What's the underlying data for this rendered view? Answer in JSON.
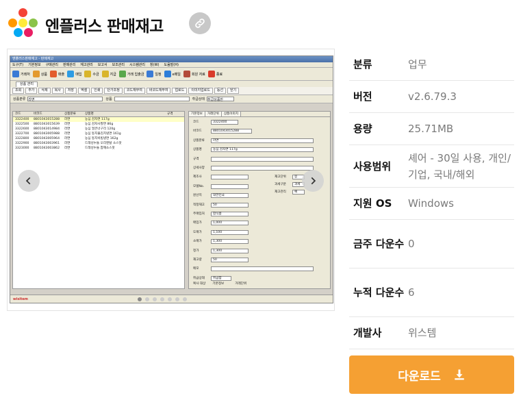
{
  "app": {
    "title": "엔플러스 판매재고",
    "logo_colors": [
      "#f44336",
      "#ff9800",
      "#ffeb3b",
      "#8bc34a",
      "#03a9f4",
      "#e91e63"
    ]
  },
  "screenshot": {
    "window_title": "엔플러스판매재고 - 판매재고",
    "menu": [
      "도구(T)",
      "기본정보",
      "구매관리",
      "판매관리",
      "재고관리",
      "보고서",
      "보조관리",
      "시스템관리",
      "창(W)",
      "도움말(H)"
    ],
    "toolbar": [
      {
        "label": "거래처",
        "color": "#3a7bd5"
      },
      {
        "label": "상품",
        "color": "#e39a2d"
      },
      {
        "label": "매출",
        "color": "#e35d2d"
      },
      {
        "label": "매입",
        "color": "#2d9ce3"
      },
      {
        "label": "수금",
        "color": "#d9b52b"
      },
      {
        "label": "지급",
        "color": "#d9b52b"
      },
      {
        "label": "거래 입출금",
        "color": "#59a84b"
      },
      {
        "label": "일정",
        "color": "#3a7bd5"
      },
      {
        "label": "e메일",
        "color": "#2d7ed9"
      },
      {
        "label": "회원 자료",
        "color": "#b34b3a"
      },
      {
        "label": "종료",
        "color": "#d93b2b"
      }
    ],
    "tab": "상품 관리",
    "subtoolbar": [
      "조회",
      "추가",
      "삭제",
      "복사",
      "저장",
      "엑셀",
      "인쇄",
      "단가조정",
      "코드재부여",
      "바코드재부여",
      "업로드",
      "이미지업로드",
      "등선",
      "닫기"
    ],
    "search": {
      "category_label": "상품분류",
      "category_value": "라면",
      "product_label": "상품",
      "status_label": "취급상태",
      "status_value": "취급상품만"
    },
    "grid": {
      "headers": [
        "코드",
        "바코드",
        "상품분류",
        "상품명",
        "규격"
      ],
      "rows": [
        [
          "3322400",
          "8801043015288",
          "라면",
          "농심 감자면 117g"
        ],
        [
          "3322500",
          "8801043015639",
          "라면",
          "농심 감자사발면 86g"
        ],
        [
          "3322600",
          "8801043014984",
          "라면",
          "농심 얼큰너구리 120g"
        ],
        [
          "3322700",
          "8801043005988",
          "라면",
          "농심 둥지물김치냉면 161g"
        ],
        [
          "3322800",
          "8801043005964",
          "라면",
          "농심 둥지비빔냉면 162g"
        ],
        [
          "3322900",
          "8801043003961",
          "라면",
          "드레싱누들 오리엔탈 소스맛"
        ],
        [
          "3323000",
          "8801043003862",
          "라면",
          "드레싱누들 참깨소스맛"
        ]
      ]
    },
    "form": {
      "tabs": [
        "기본정보",
        "거래단위",
        "상품이미지"
      ],
      "fields": [
        {
          "label": "코드",
          "value": "3322400"
        },
        {
          "label": "바코드",
          "value": "8801043015288"
        },
        {
          "label": "상품분류",
          "value": "라면"
        },
        {
          "label": "상품명",
          "value": "농심 감자면 117g"
        },
        {
          "label": "규격",
          "value": ""
        },
        {
          "label": "상세사양",
          "value": ""
        },
        {
          "label": "제조사",
          "value": ""
        },
        {
          "label": "모델No.",
          "value": ""
        },
        {
          "label": "원산지",
          "value": "대한민국"
        },
        {
          "label": "적정재고",
          "value": "50"
        },
        {
          "label": "주매입처",
          "value": "합식품"
        },
        {
          "label": "매입가",
          "value": "1,000"
        },
        {
          "label": "도매가",
          "value": "1,100"
        },
        {
          "label": "소매가",
          "value": "1,300"
        },
        {
          "label": "정가",
          "value": "1,300"
        },
        {
          "label": "재고량",
          "value": "50"
        },
        {
          "label": "메모",
          "value": ""
        },
        {
          "label": "취급상태",
          "value": "취급함"
        }
      ],
      "right_fields": [
        {
          "label": "재고단위",
          "value": "봉"
        },
        {
          "label": "과세구분",
          "value": "과세"
        },
        {
          "label": "재고관리",
          "value": "예"
        }
      ],
      "copy_label": "복사 대상",
      "copy_options": [
        "기본정보",
        "거래단위"
      ]
    },
    "statusbar_logo": "wisitem"
  },
  "info": [
    {
      "key": "분류",
      "value": "업무",
      "link": true
    },
    {
      "key": "버전",
      "value": "v2.6.79.3"
    },
    {
      "key": "용량",
      "value": "25.71MB"
    },
    {
      "key": "사용범위",
      "value": "셰어 - 30일 사용, 개인/기업, 국내/해외"
    },
    {
      "key": "지원 OS",
      "value": "Windows"
    },
    {
      "key": "금주 다운수",
      "value": "0"
    },
    {
      "key": "누적 다운수",
      "value": "6"
    },
    {
      "key": "개발사",
      "value": "위스템"
    }
  ],
  "download": {
    "label": "다운로드"
  }
}
